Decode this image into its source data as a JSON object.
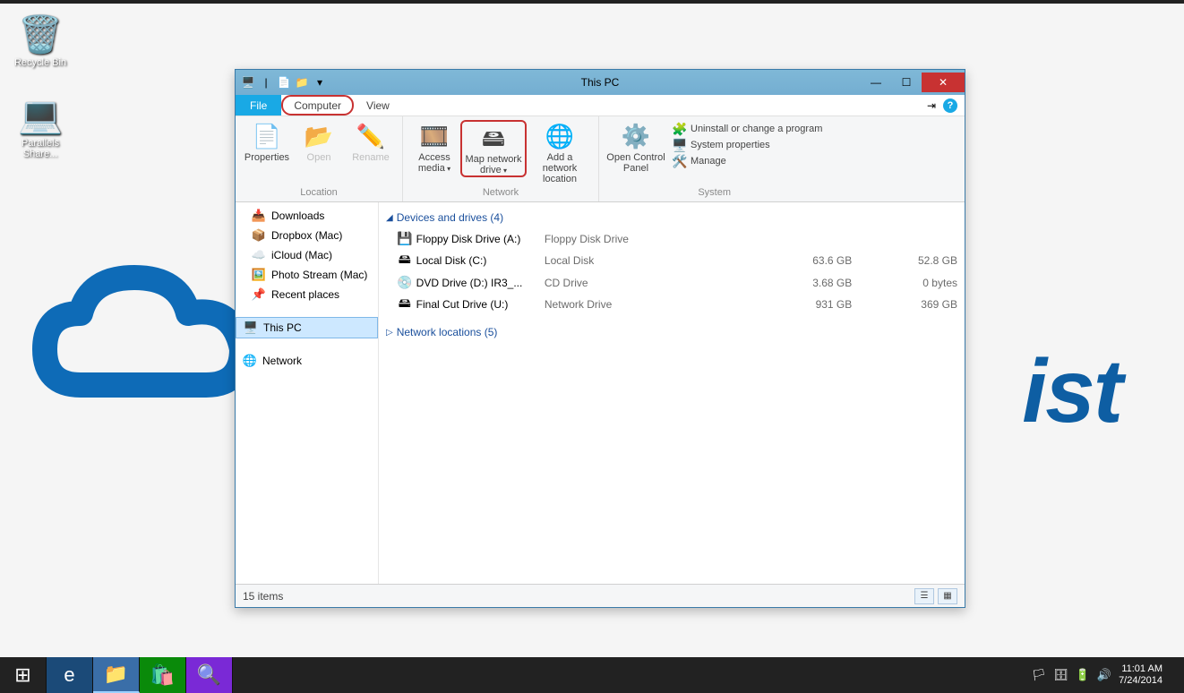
{
  "desktop": {
    "icons": [
      {
        "name": "recycle-bin",
        "label": "Recycle Bin",
        "glyph": "🗑️"
      },
      {
        "name": "parallels-share",
        "label": "Parallels Share...",
        "glyph": "💻"
      }
    ],
    "brand_fragment": "ist"
  },
  "window": {
    "title": "This PC",
    "qat": {
      "save_glyph": "📄",
      "open_glyph": "📁",
      "sep": "|",
      "dropdown_glyph": "▾"
    },
    "tabs": {
      "file": "File",
      "computer": "Computer",
      "view": "View"
    },
    "tab_right": {
      "minimize_ribbon": "⇥"
    },
    "ribbon": {
      "location": {
        "label": "Location",
        "properties": "Properties",
        "open": "Open",
        "rename": "Rename"
      },
      "network": {
        "label": "Network",
        "access_media": "Access media",
        "map_drive": "Map network drive",
        "add_location": "Add a network location"
      },
      "system": {
        "label": "System",
        "open_cp": "Open Control Panel",
        "uninstall": "Uninstall or change a program",
        "properties": "System properties",
        "manage": "Manage"
      }
    },
    "nav": {
      "fav": [
        {
          "name": "downloads",
          "label": "Downloads",
          "glyph": "📥"
        },
        {
          "name": "dropbox",
          "label": "Dropbox (Mac)",
          "glyph": "📦"
        },
        {
          "name": "icloud",
          "label": "iCloud (Mac)",
          "glyph": "☁️"
        },
        {
          "name": "photostream",
          "label": "Photo Stream (Mac)",
          "glyph": "🖼️"
        },
        {
          "name": "recent",
          "label": "Recent places",
          "glyph": "📌"
        }
      ],
      "this_pc": "This PC",
      "network": "Network"
    },
    "content": {
      "devices_header": "Devices and drives (4)",
      "network_header": "Network locations (5)",
      "drives": [
        {
          "name": "Floppy Disk Drive (A:)",
          "type": "Floppy Disk Drive",
          "size": "",
          "free": "",
          "glyph": "💾"
        },
        {
          "name": "Local Disk (C:)",
          "type": "Local Disk",
          "size": "63.6 GB",
          "free": "52.8 GB",
          "glyph": "🖴"
        },
        {
          "name": "DVD Drive (D:) IR3_...",
          "type": "CD Drive",
          "size": "3.68 GB",
          "free": "0 bytes",
          "glyph": "💿"
        },
        {
          "name": "Final Cut Drive (U:)",
          "type": "Network Drive",
          "size": "931 GB",
          "free": "369 GB",
          "glyph": "🖴"
        }
      ]
    },
    "status": {
      "text": "15 items"
    }
  },
  "taskbar": {
    "start_glyph": "⊞",
    "apps": [
      {
        "name": "ie",
        "glyph": "🌐",
        "color": "#1b6fb5"
      },
      {
        "name": "explorer",
        "glyph": "📁",
        "active": true
      },
      {
        "name": "store",
        "glyph": "🛍️",
        "color": "#0a8a0a"
      },
      {
        "name": "search",
        "glyph": "🔍",
        "purple": true
      }
    ],
    "tray_icons": [
      "🏳",
      "🗄",
      "🔋",
      "🔊"
    ],
    "time": "11:01 AM",
    "date": "7/24/2014"
  }
}
